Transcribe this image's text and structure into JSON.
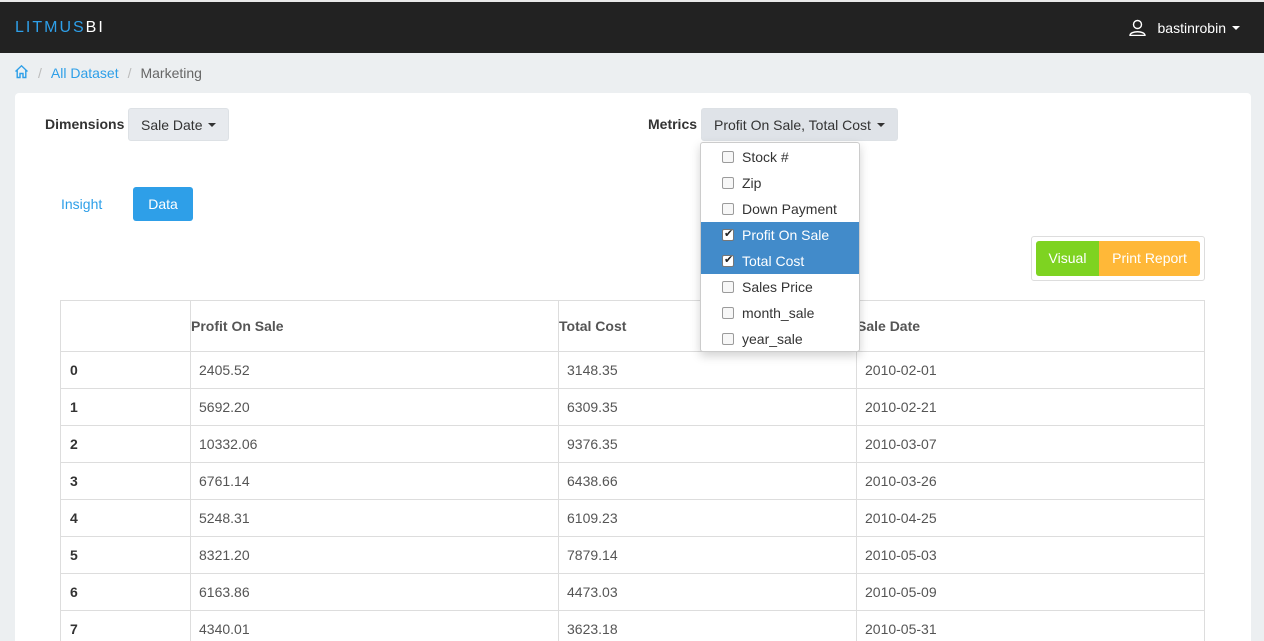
{
  "app": {
    "brand_part1": "LITMUS",
    "brand_part2": "BI",
    "username": "bastinrobin"
  },
  "breadcrumb": {
    "home_icon": "home-icon",
    "link": "All Dataset",
    "active": "Marketing"
  },
  "controls": {
    "dimensions_label": "Dimensions",
    "dimensions_value": "Sale Date",
    "metrics_label": "Metrics",
    "metrics_value": "Profit On Sale, Total Cost"
  },
  "metrics_options": [
    {
      "label": "Stock #",
      "checked": false
    },
    {
      "label": "Zip",
      "checked": false
    },
    {
      "label": "Down Payment",
      "checked": false
    },
    {
      "label": "Profit On Sale",
      "checked": true
    },
    {
      "label": "Total Cost",
      "checked": true
    },
    {
      "label": "Sales Price",
      "checked": false
    },
    {
      "label": "month_sale",
      "checked": false
    },
    {
      "label": "year_sale",
      "checked": false
    }
  ],
  "tabs": {
    "insight": "Insight",
    "data": "Data"
  },
  "actions": {
    "visual": "Visual",
    "print": "Print Report"
  },
  "table": {
    "headers": [
      "",
      "Profit On Sale",
      "Total Cost",
      "Sale Date"
    ],
    "rows": [
      [
        "0",
        "2405.52",
        "3148.35",
        "2010-02-01"
      ],
      [
        "1",
        "5692.20",
        "6309.35",
        "2010-02-21"
      ],
      [
        "2",
        "10332.06",
        "9376.35",
        "2010-03-07"
      ],
      [
        "3",
        "6761.14",
        "6438.66",
        "2010-03-26"
      ],
      [
        "4",
        "5248.31",
        "6109.23",
        "2010-04-25"
      ],
      [
        "5",
        "8321.20",
        "7879.14",
        "2010-05-03"
      ],
      [
        "6",
        "6163.86",
        "4473.03",
        "2010-05-09"
      ],
      [
        "7",
        "4340.01",
        "3623.18",
        "2010-05-31"
      ]
    ]
  },
  "colors": {
    "accent": "#2e9fe8",
    "navbar": "#222222",
    "visual": "#7ed321",
    "print": "#ffb838",
    "selected": "#428bca"
  }
}
